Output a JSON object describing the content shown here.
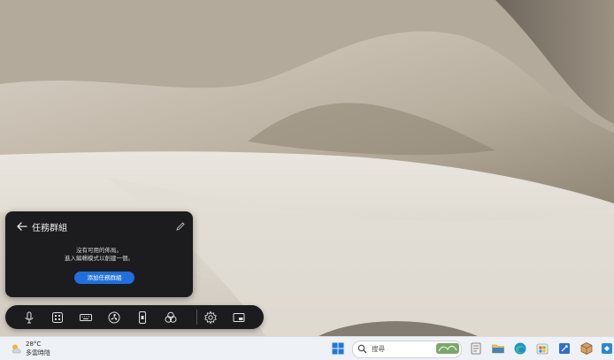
{
  "task_group_panel": {
    "title": "任務群組",
    "empty_line1": "沒有可用的佈局。",
    "empty_line2": "進入編輯模式以創建一個。",
    "add_button": "添加任務群組"
  },
  "toolbar": {
    "items": [
      "microphone-icon",
      "apps-grid-icon",
      "keyboard-icon",
      "fan-icon",
      "phone-icon",
      "color-circles-icon",
      "settings-icon",
      "picture-in-picture-icon"
    ]
  },
  "taskbar": {
    "weather_temp": "28°C",
    "weather_desc": "多雲時陰",
    "search_placeholder": "搜尋",
    "apps": [
      "start-icon",
      "file-manager-icon",
      "edge-icon",
      "store-icon",
      "editor-icon",
      "terminal-icon",
      "app-icon"
    ]
  },
  "colors": {
    "panel_bg": "#1c1c1e",
    "accent": "#1f6fe0",
    "taskbar_bg": "#eef1f5"
  }
}
